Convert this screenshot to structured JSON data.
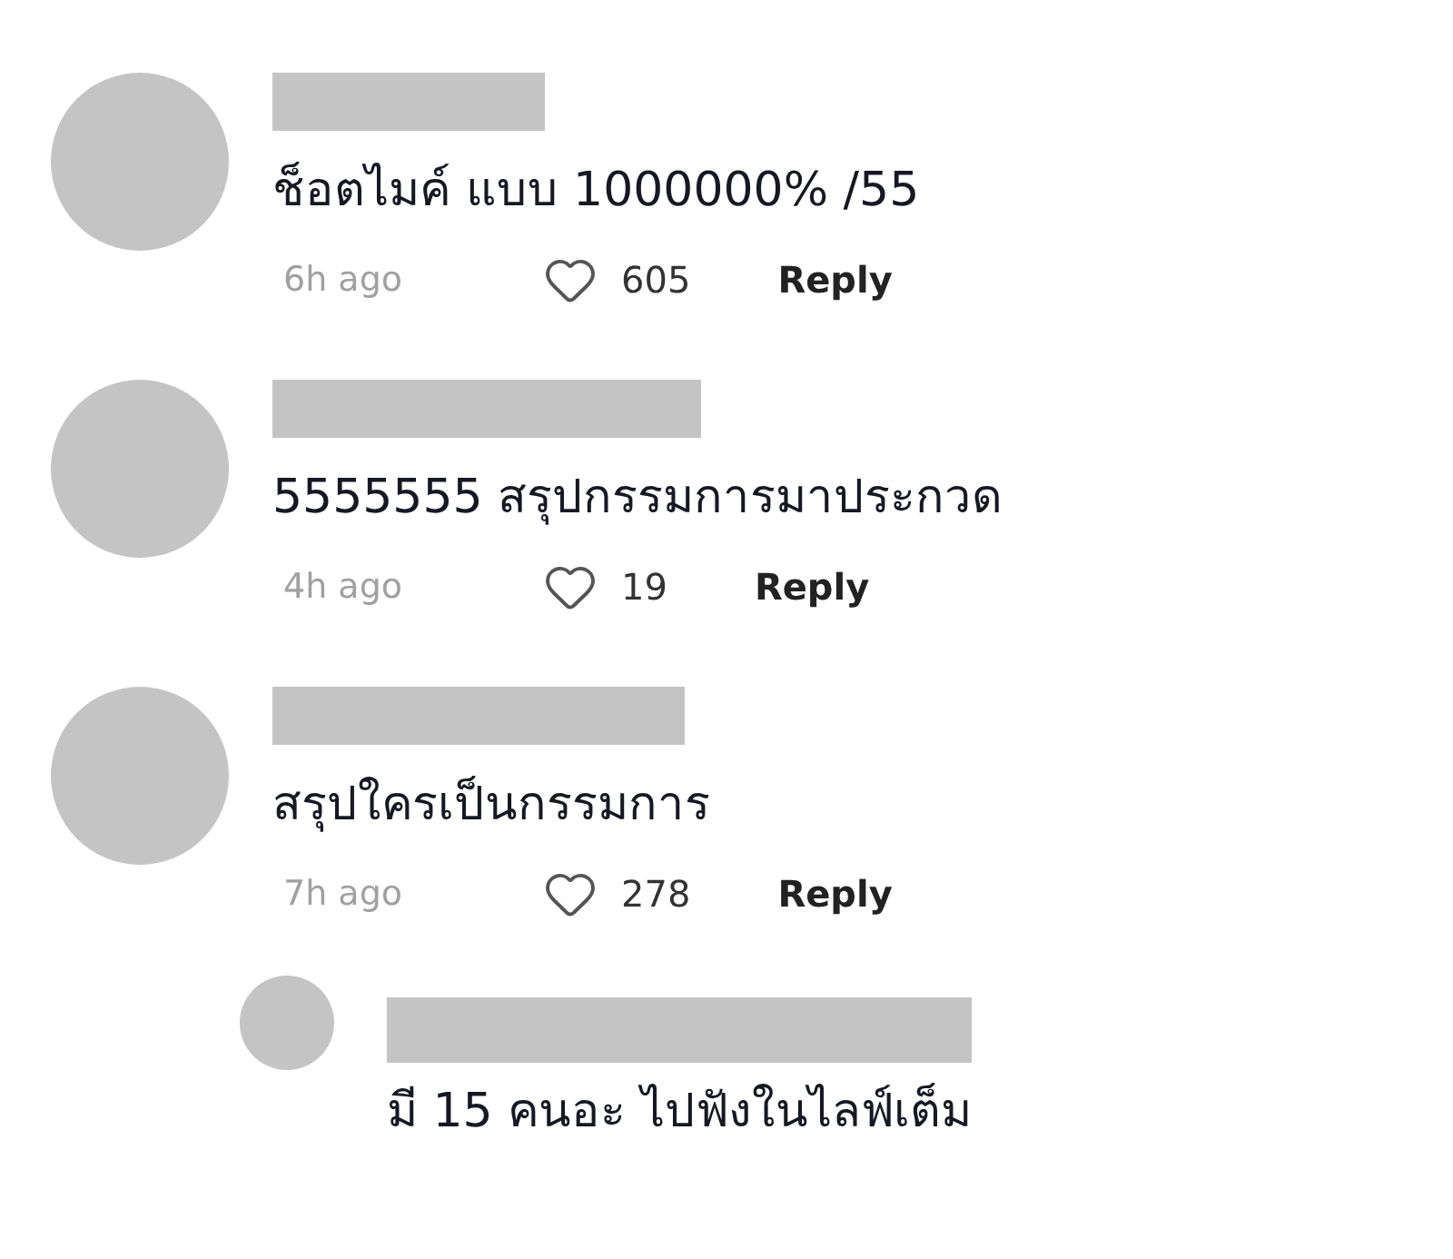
{
  "comments": [
    {
      "author_hidden": true,
      "text": "ช็อตไมค์ แบบ 1000000% /55",
      "time": "6h ago",
      "likes": "605",
      "reply": "Reply"
    },
    {
      "author_hidden": true,
      "text": "5555555 สรุปกรรมการมาประกวด",
      "time": "4h ago",
      "likes": "19",
      "reply": "Reply"
    },
    {
      "author_hidden": true,
      "text": "สรุปใครเป็นกรรมการ",
      "time": "7h ago",
      "likes": "278",
      "reply": "Reply",
      "replies": [
        {
          "author_hidden": true,
          "text": "มี 15 คนอะ ไปฟังในไลฟ์เต็ม"
        }
      ]
    }
  ]
}
